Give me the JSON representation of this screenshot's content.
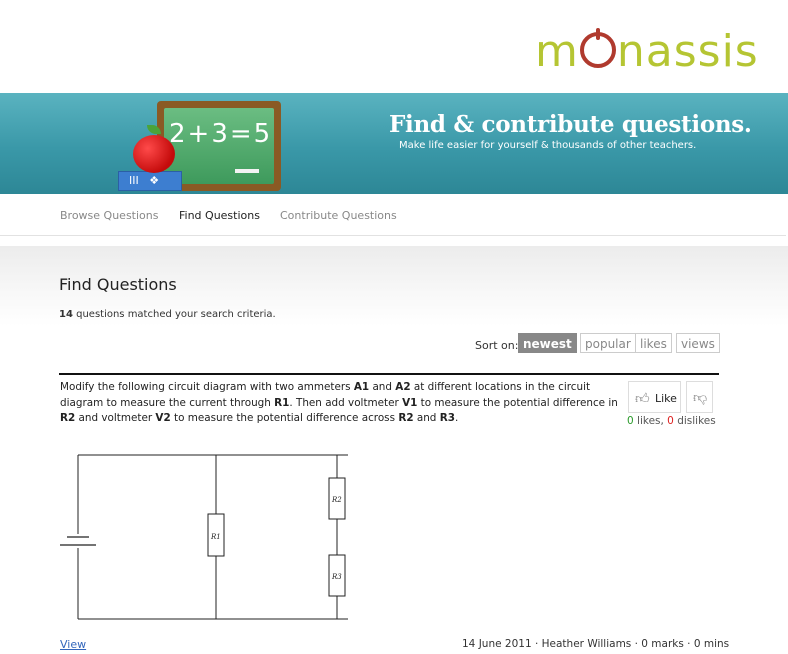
{
  "logo": {
    "text_before": "m",
    "text_after": "nassis"
  },
  "banner": {
    "title": "Find & contribute questions.",
    "subtitle": "Make life easier for yourself & thousands of other teachers.",
    "board_text": "2+3=5"
  },
  "nav": {
    "items": [
      {
        "label": "Browse Questions",
        "active": false
      },
      {
        "label": "Find Questions",
        "active": true
      },
      {
        "label": "Contribute Questions",
        "active": false
      }
    ]
  },
  "page": {
    "title": "Find Questions",
    "count": "14",
    "count_suffix": " questions matched your search criteria."
  },
  "sort": {
    "label": "Sort on:",
    "options": [
      "newest",
      "popular",
      "likes",
      "views"
    ],
    "selected": "newest"
  },
  "question": {
    "t1": "Modify the following circuit diagram with two ammeters ",
    "b1": "A1",
    "t2": " and ",
    "b2": "A2",
    "t3": " at different locations in the circuit diagram to measure the current through ",
    "b3": "R1",
    "t4": ". Then add voltmeter ",
    "b4": "V1",
    "t5": " to measure the potential difference in ",
    "b5": "R2",
    "t6": " and voltmeter ",
    "b6": "V2",
    "t7": " to measure the potential difference across ",
    "b7": "R2",
    "t8": " and ",
    "b8": "R3",
    "t9": ".",
    "like_label": "Like",
    "likes": "0",
    "likes_suffix": " likes, ",
    "dislikes": "0",
    "dislikes_suffix": " dislikes",
    "circuit_labels": {
      "r1": "R1",
      "r2": "R2",
      "r3": "R3"
    },
    "view_label": "View",
    "meta": "14 June 2011 · Heather Williams · 0 marks · 0 mins"
  },
  "colors": {
    "brand": "#b5c533",
    "banner": "#3a98a8",
    "likes": "#2a9a2a",
    "dislikes": "#dd2222"
  }
}
